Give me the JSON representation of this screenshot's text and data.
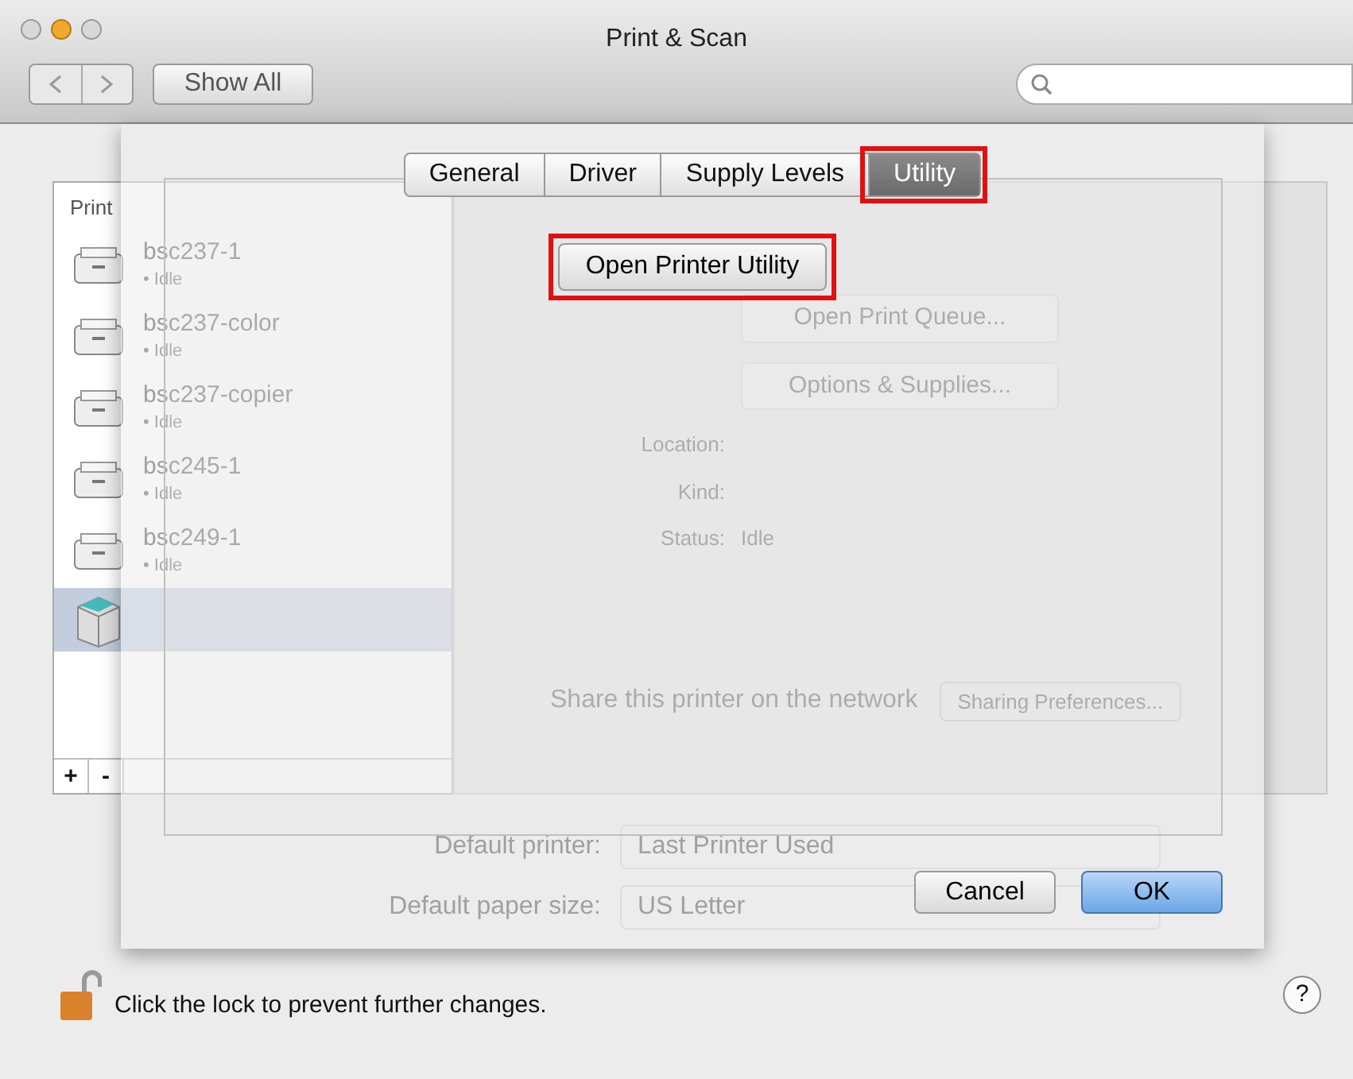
{
  "window": {
    "title": "Print & Scan"
  },
  "toolbar": {
    "show_all": "Show All"
  },
  "printers": {
    "header": "Print",
    "items": [
      {
        "kind": "printer",
        "name": "bsc237-1",
        "status": "• Idle",
        "selected": false
      },
      {
        "kind": "printer",
        "name": "bsc237-color",
        "status": "• Idle",
        "selected": false
      },
      {
        "kind": "printer",
        "name": "bsc237-copier",
        "status": "• Idle",
        "selected": false
      },
      {
        "kind": "printer",
        "name": "bsc245-1",
        "status": "• Idle",
        "selected": false
      },
      {
        "kind": "printer",
        "name": "bsc249-1",
        "status": "• Idle",
        "selected": false
      },
      {
        "kind": "copier",
        "selected": true
      }
    ],
    "list_buttons": [
      "+",
      "-"
    ]
  },
  "detail": {
    "buttons": [
      "Open Print Queue...",
      "Options & Supplies..."
    ],
    "fields": [
      {
        "label": "Location:"
      },
      {
        "label": "Kind:"
      },
      {
        "label": "Status:",
        "value": "Idle"
      }
    ],
    "share": "Share this printer on the network",
    "sharing_button": "Sharing Preferences..."
  },
  "defaults": [
    {
      "label": "Default printer:",
      "value": "Last Printer Used"
    },
    {
      "label": "Default paper size:",
      "value": "US Letter"
    }
  ],
  "sheet": {
    "tabs": [
      {
        "label": "General",
        "selected": false,
        "highlighted": false
      },
      {
        "label": "Driver",
        "selected": false,
        "highlighted": false
      },
      {
        "label": "Supply Levels",
        "selected": false,
        "highlighted": false
      },
      {
        "label": "Utility",
        "selected": true,
        "highlighted": true
      }
    ],
    "utility_button": {
      "label": "Open Printer Utility",
      "highlighted": true
    },
    "buttons": [
      {
        "label": "Cancel",
        "default": false
      },
      {
        "label": "OK",
        "default": true
      }
    ]
  },
  "footer": {
    "lock_text": "Click the lock to prevent further changes.",
    "locked": false,
    "help": "?"
  }
}
